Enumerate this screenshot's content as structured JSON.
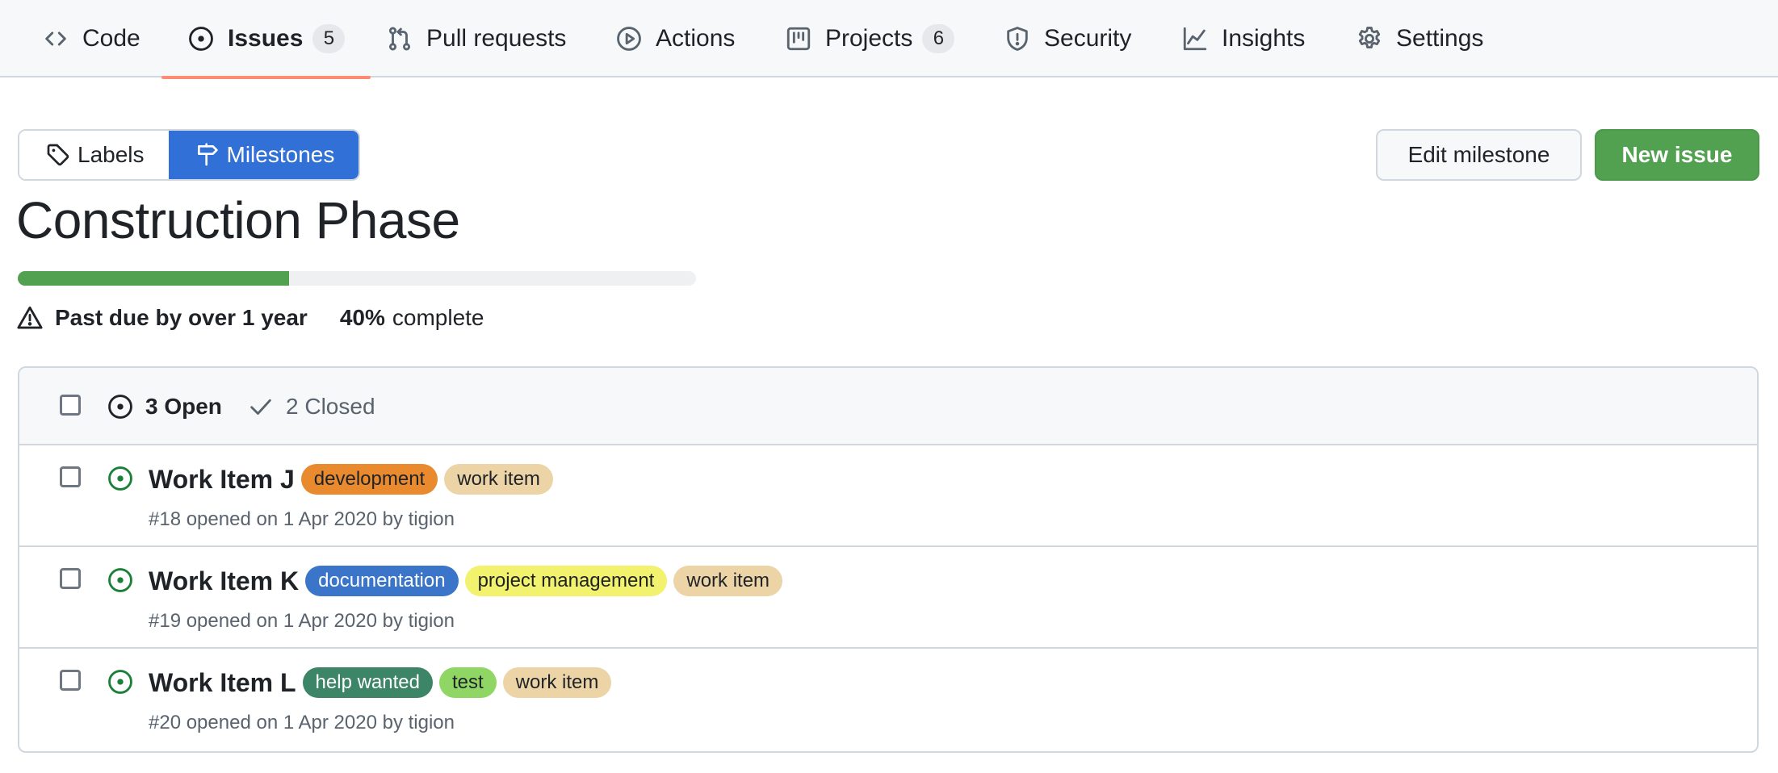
{
  "nav": {
    "tabs": [
      {
        "label": "Code",
        "icon": "code-icon"
      },
      {
        "label": "Issues",
        "icon": "issue-opened-icon",
        "count": "5",
        "selected": true
      },
      {
        "label": "Pull requests",
        "icon": "git-pull-request-icon"
      },
      {
        "label": "Actions",
        "icon": "play-icon"
      },
      {
        "label": "Projects",
        "icon": "project-icon",
        "count": "6"
      },
      {
        "label": "Security",
        "icon": "shield-icon"
      },
      {
        "label": "Insights",
        "icon": "graph-icon"
      },
      {
        "label": "Settings",
        "icon": "gear-icon"
      }
    ]
  },
  "subnav": {
    "labels": "Labels",
    "milestones": "Milestones"
  },
  "actions": {
    "edit_milestone": "Edit milestone",
    "new_issue": "New issue"
  },
  "milestone": {
    "title": "Construction Phase",
    "progress_percent": 40,
    "due_status": "Past due by over 1 year",
    "percent_text": "40%",
    "complete_text": "complete"
  },
  "filters": {
    "open": "3 Open",
    "closed": "2 Closed"
  },
  "issues": [
    {
      "title": "Work Item J",
      "meta": "#18 opened on 1 Apr 2020 by tigion",
      "labels": [
        {
          "name": "development",
          "bg": "#ea8a2f",
          "fg": "#1f2328"
        },
        {
          "name": "work item",
          "bg": "#ecd4a6",
          "fg": "#1f2328"
        }
      ]
    },
    {
      "title": "Work Item K",
      "meta": "#19 opened on 1 Apr 2020 by tigion",
      "labels": [
        {
          "name": "documentation",
          "bg": "#3a75c9",
          "fg": "#ffffff"
        },
        {
          "name": "project management",
          "bg": "#f2f26e",
          "fg": "#1f2328"
        },
        {
          "name": "work item",
          "bg": "#ecd4a6",
          "fg": "#1f2328"
        }
      ]
    },
    {
      "title": "Work Item L",
      "meta": "#20 opened on 1 Apr 2020 by tigion",
      "labels": [
        {
          "name": "help wanted",
          "bg": "#3c8566",
          "fg": "#ffffff"
        },
        {
          "name": "test",
          "bg": "#8fd665",
          "fg": "#1f2328"
        },
        {
          "name": "work item",
          "bg": "#ecd4a6",
          "fg": "#1f2328"
        }
      ]
    }
  ],
  "colors": {
    "accent_blue": "#3170d6",
    "success_green": "#52a150",
    "open_issue_green": "#1a7f37",
    "selected_tab_underline": "#fd8c73"
  }
}
